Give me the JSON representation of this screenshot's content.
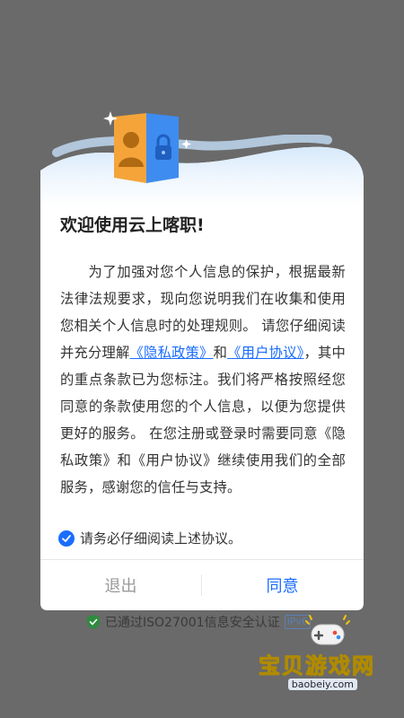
{
  "dialog": {
    "title": "欢迎使用云上喀职!",
    "paragraph": {
      "part1": "为了加强对您个人信息的保护，根据最新法律法规要求，现向您说明我们在收集和使用您相关个人信息时的处理规则。 请您仔细阅读并充分理解",
      "privacy_link": "《隐私政策》",
      "and_1": "和",
      "terms_link": "《用户协议》",
      "part2": "，其中的重点条款已为您标注。我们将严格按照经您同意的条款使用您的个人信息，以便为您提供更好的服务。 在您注册或登录时需要同意《隐私政策》和《用户协议》继续使用我们的全部服务，感谢您的信任与支持。"
    },
    "agree_checkbox_label": "请务必仔细阅读上述协议。",
    "agree_checkbox_checked": true,
    "exit_button": "退出",
    "agree_button": "同意"
  },
  "certification": {
    "text": "已通过ISO27001信息安全认证",
    "badge": "IPv6"
  },
  "watermark": {
    "title": "宝贝游戏网",
    "url": "baobeiy.com"
  },
  "colors": {
    "accent": "#1a6dff",
    "overlay": "#6a6a6a",
    "cert_shield": "#2e8b3e",
    "watermark": "#f5c400"
  },
  "icons": [
    "person-card-icon",
    "lock-icon",
    "sparkle-icon",
    "check-icon",
    "shield-check-icon",
    "gamepad-icon"
  ]
}
